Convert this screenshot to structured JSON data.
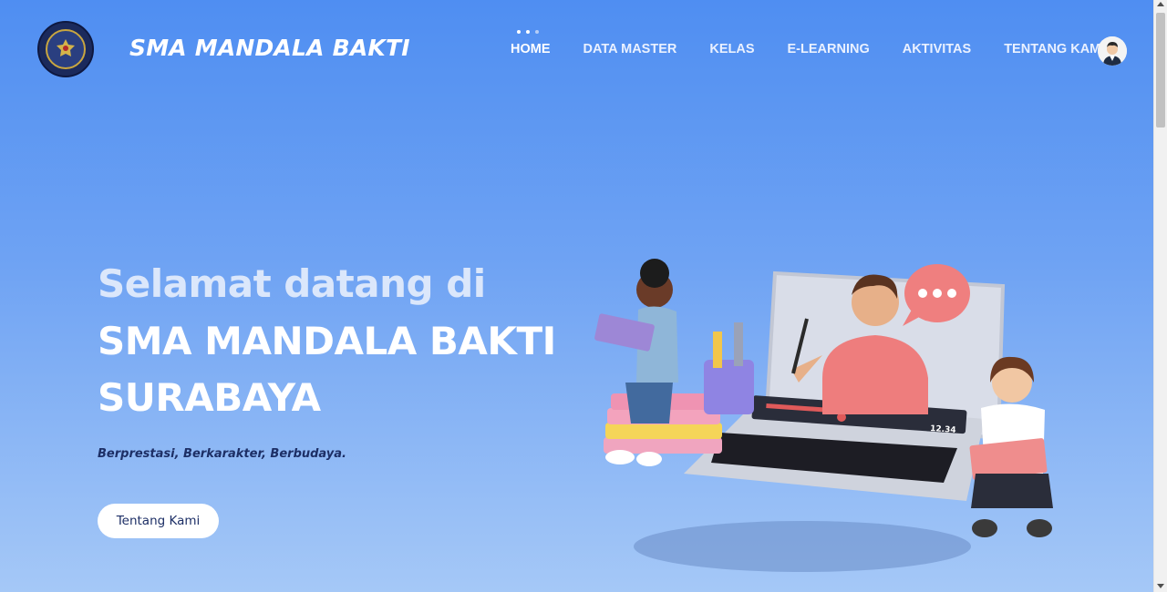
{
  "header": {
    "brand": "SMA MANDALA BAKTI",
    "nav": [
      {
        "label": "HOME",
        "active": true
      },
      {
        "label": "DATA MASTER"
      },
      {
        "label": "KELAS"
      },
      {
        "label": "E-LEARNING"
      },
      {
        "label": "AKTIVITAS"
      },
      {
        "label": "TENTANG KAMI"
      }
    ],
    "icons": {
      "logo": "school-emblem-icon",
      "avatar": "user-avatar-icon"
    }
  },
  "hero": {
    "line1": "Selamat datang di",
    "line2": "SMA MANDALA BAKTI",
    "line3": "SURABAYA",
    "tagline": "Berprestasi, Berkarakter, Berbudaya.",
    "cta_label": "Tentang Kami",
    "video_time": "12.34"
  },
  "colors": {
    "background_top": "#4f8ef2",
    "background_bottom": "#a5c8f7",
    "tagline": "#1d2f66"
  }
}
